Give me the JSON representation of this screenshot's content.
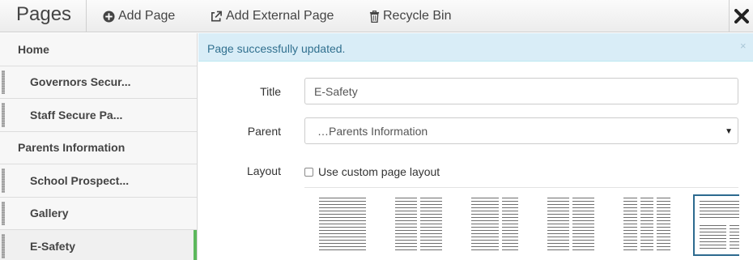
{
  "toolbar": {
    "title": "Pages",
    "add_page": "Add Page",
    "add_external_page": "Add External Page",
    "recycle_bin": "Recycle Bin",
    "close_icon": "close-icon"
  },
  "sidebar": {
    "items": [
      {
        "label": "Home",
        "level": 0
      },
      {
        "label": "Governors Secur...",
        "level": 1
      },
      {
        "label": "Staff Secure Pa...",
        "level": 1
      },
      {
        "label": "Parents Information",
        "level": 0
      },
      {
        "label": "School Prospect...",
        "level": 1
      },
      {
        "label": "Gallery",
        "level": 1
      },
      {
        "label": "E-Safety",
        "level": 1,
        "active": true
      }
    ],
    "active_color": "#5cb85c"
  },
  "alert": {
    "message": "Page successfully updated.",
    "close": "×"
  },
  "form": {
    "title_label": "Title",
    "title_value": "E-Safety",
    "parent_label": "Parent",
    "parent_value": "…Parents Information",
    "layout_label": "Layout",
    "custom_layout_label": "Use custom page layout",
    "custom_layout_checked": false
  },
  "layouts": [
    {
      "name": "one-column",
      "selected": false
    },
    {
      "name": "two-column",
      "selected": false
    },
    {
      "name": "two-column-uneven",
      "selected": false
    },
    {
      "name": "two-column-alt",
      "selected": false
    },
    {
      "name": "three-column",
      "selected": false
    },
    {
      "name": "header-with-columns",
      "selected": true
    }
  ],
  "colors": {
    "alert_bg": "#d9edf7",
    "alert_text": "#31708f",
    "selected_layout_border": "#2d6a8f"
  }
}
